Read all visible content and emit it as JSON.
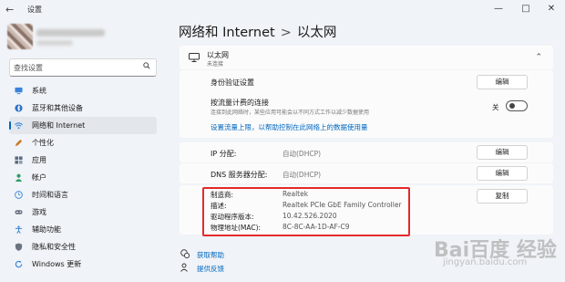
{
  "window": {
    "back_icon": "back-arrow-icon",
    "title": "设置",
    "controls": [
      "minimize-icon",
      "maximize-icon",
      "close-icon"
    ]
  },
  "sidebar": {
    "search_placeholder": "查找设置",
    "search_icon": "search-icon",
    "items": [
      {
        "label": "系统",
        "icon": "monitor-icon",
        "color": "#3b84d9"
      },
      {
        "label": "蓝牙和其他设备",
        "icon": "bluetooth-icon",
        "color": "#2a6fc9"
      },
      {
        "label": "网络和 Internet",
        "icon": "wifi-icon",
        "color": "#3b84d9",
        "selected": true
      },
      {
        "label": "个性化",
        "icon": "pen-icon",
        "color": "#c97a2a"
      },
      {
        "label": "应用",
        "icon": "apps-icon",
        "color": "#5a6b80"
      },
      {
        "label": "帐户",
        "icon": "person-icon",
        "color": "#2c9c68"
      },
      {
        "label": "时间和语言",
        "icon": "globe-clock-icon",
        "color": "#3b84d9"
      },
      {
        "label": "游戏",
        "icon": "gamepad-icon",
        "color": "#6b7280"
      },
      {
        "label": "辅助功能",
        "icon": "accessibility-icon",
        "color": "#3b84d9"
      },
      {
        "label": "隐私和安全性",
        "icon": "shield-icon",
        "color": "#6b7280"
      },
      {
        "label": "Windows 更新",
        "icon": "refresh-icon",
        "color": "#3b84d9"
      }
    ]
  },
  "breadcrumb": {
    "parent": "网络和 Internet",
    "separator": ">",
    "current": "以太网"
  },
  "ethernet": {
    "title": "以太网",
    "status": "未连接",
    "icon": "ethernet-icon",
    "collapse_icon": "chevron-up-icon"
  },
  "auth": {
    "label": "身份验证设置",
    "button": "编辑"
  },
  "metered": {
    "label": "按流量计费的连接",
    "description": "连接到此网络时，某些应用可能会以不同方式工作以减少数据使用",
    "toggle_label": "关",
    "toggle_on": false
  },
  "data_limit_link": "设置流量上限，以帮助控制在此网络上的数据使用量",
  "ip": {
    "label": "IP 分配:",
    "value": "自动(DHCP)",
    "button": "编辑"
  },
  "dns": {
    "label": "DNS 服务器分配:",
    "value": "自动(DHCP)",
    "button": "编辑"
  },
  "adapter": {
    "rows": [
      {
        "label": "制造商:",
        "value": "Realtek"
      },
      {
        "label": "描述:",
        "value": "Realtek PCIe GbE Family Controller"
      },
      {
        "label": "驱动程序版本:",
        "value": "10.42.526.2020"
      },
      {
        "label": "物理地址(MAC):",
        "value": "8C-8C-AA-1D-AF-C9"
      }
    ],
    "copy_button": "复制",
    "highlight_color": "#e32a2a"
  },
  "help": {
    "get_help": "获取帮助",
    "get_help_icon": "help-chat-icon",
    "feedback": "提供反馈",
    "feedback_icon": "feedback-icon"
  },
  "watermark": {
    "text": "Bai百度 经验",
    "sub": "jingyan.baidu.com"
  }
}
